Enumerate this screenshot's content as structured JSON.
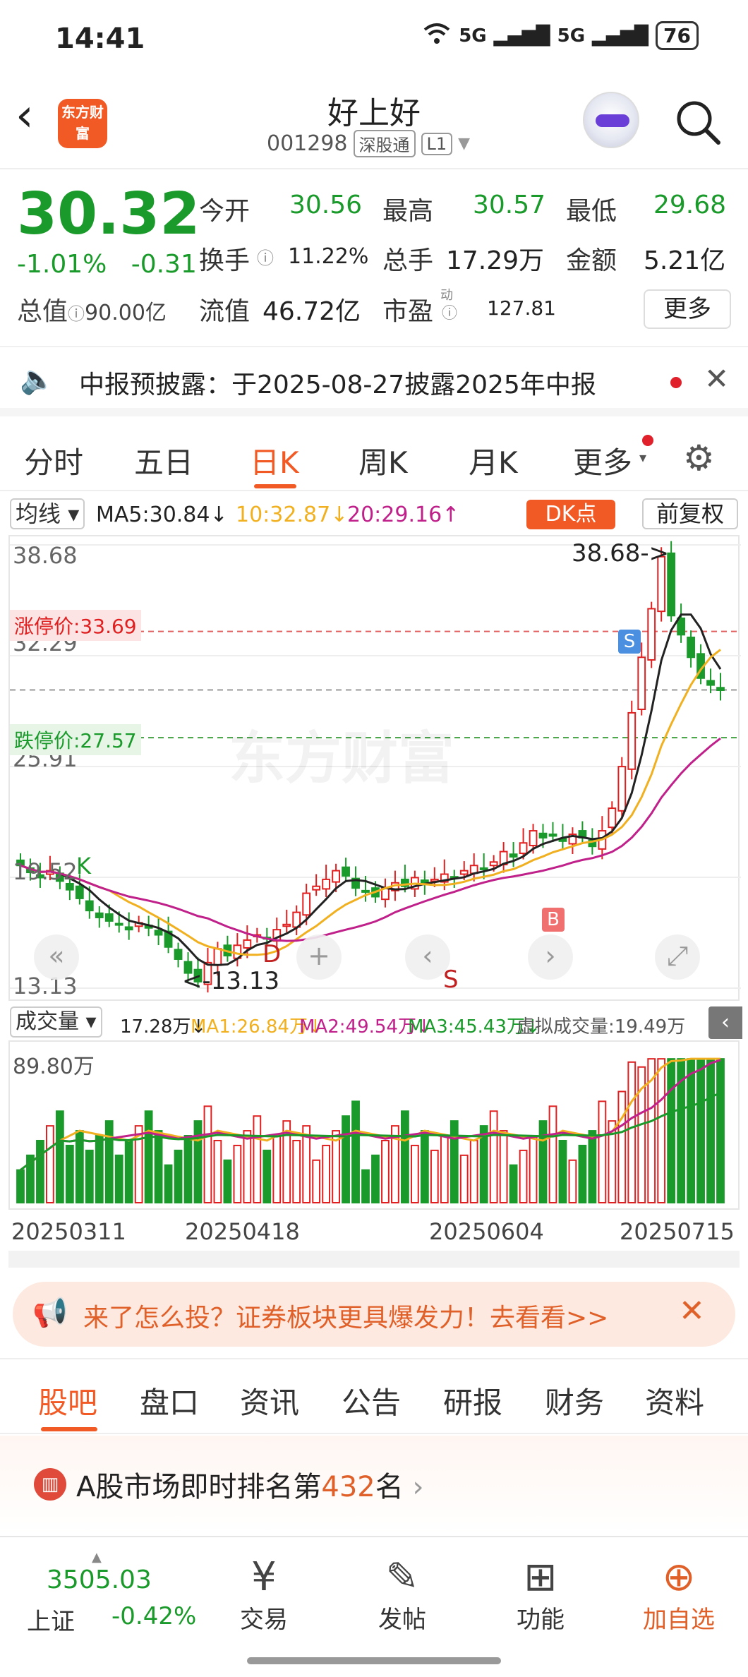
{
  "status_bar": {
    "time": "14:41",
    "signal1": "5G",
    "signal2": "5G",
    "battery": "76"
  },
  "header": {
    "logo": "东方财富",
    "name": "好上好",
    "code": "001298",
    "tag1": "深股通",
    "tag2": "L1"
  },
  "quote": {
    "price": "30.32",
    "change_pct": "-1.01%",
    "change": "-0.31",
    "items": [
      {
        "label": "今开",
        "value": "30.56",
        "color": "green"
      },
      {
        "label": "最高",
        "value": "30.57",
        "color": "green"
      },
      {
        "label": "最低",
        "value": "29.68",
        "color": "green"
      },
      {
        "label": "换手",
        "value": "11.22%",
        "color": "black"
      },
      {
        "label": "总手",
        "value": "17.29万",
        "color": "black"
      },
      {
        "label": "金额",
        "value": "5.21亿",
        "color": "black"
      },
      {
        "label": "流值",
        "value": "46.72亿",
        "color": "black"
      },
      {
        "label": "市盈",
        "value": "127.81",
        "color": "black"
      }
    ],
    "total_value_label": "总值",
    "total_value": "90.00亿",
    "pe_superscript": "动",
    "more": "更多"
  },
  "notice": {
    "text": "中报预披露：于2025-08-27披露2025年中报"
  },
  "chart_tabs": [
    "分时",
    "五日",
    "日K",
    "周K",
    "月K",
    "更多"
  ],
  "chart_tabs_active": "日K",
  "ma_row": {
    "selector": "均线",
    "ma5": "MA5:30.84↓",
    "ma10": "10:32.87↓",
    "ma20": "20:29.16↑",
    "dk": "DK点",
    "fq": "前复权"
  },
  "kline": {
    "y_high": "38.68",
    "y_mid1": "32.29",
    "y_mid2": "25.91",
    "y_mid3": "19.52",
    "y_low": "13.13",
    "limit_up": "涨停价:33.69",
    "limit_down": "跌停价:27.57",
    "max_marker": "38.68->",
    "min_marker": "<-13.13",
    "s_mark": "S",
    "b_mark": "B",
    "d_mark": "D",
    "k_mark": "K",
    "watermark": "东方财富"
  },
  "vol_row": {
    "selector": "成交量",
    "vol": "17.28万↓",
    "ma1": "MA1:26.84万↓",
    "ma2": "MA2:49.54万↓",
    "ma3": "MA3:45.43万↓",
    "virtual": "虚拟成交量:19.49万",
    "y_max": "89.80万"
  },
  "x_dates": [
    "20250311",
    "20250418",
    "20250604",
    "20250715"
  ],
  "ad": {
    "text": "来了怎么投？证券板块更具爆发力！去看看>>"
  },
  "info_tabs": [
    "股吧",
    "盘口",
    "资讯",
    "公告",
    "研报",
    "财务",
    "资料"
  ],
  "rank": {
    "prefix": "A股市场即时排名第",
    "num": "432",
    "suffix": "名"
  },
  "bottom_nav": {
    "index_value": "3505.03",
    "index_name": "上证",
    "index_change": "-0.42%",
    "items": [
      "交易",
      "发帖",
      "功能",
      "加自选"
    ]
  },
  "colors": {
    "up": "#e02020",
    "down": "#1a9a2a",
    "accent": "#f15a24",
    "ma5": "#222222",
    "ma10": "#f0b020",
    "ma20": "#c0208a"
  },
  "chart_data": {
    "type": "candlestick",
    "ylim": [
      13.13,
      38.68
    ],
    "closes": [
      20.2,
      19.8,
      19.5,
      19.9,
      19.3,
      18.8,
      18.3,
      17.6,
      17.2,
      17.0,
      16.8,
      16.5,
      16.9,
      16.6,
      16.2,
      15.5,
      14.8,
      14.0,
      13.5,
      14.6,
      15.4,
      15.0,
      15.6,
      15.9,
      16.2,
      16.0,
      16.5,
      16.8,
      17.5,
      18.6,
      19.0,
      19.4,
      19.9,
      19.6,
      18.9,
      18.7,
      18.4,
      18.9,
      19.2,
      19.0,
      19.5,
      19.1,
      19.4,
      19.7,
      19.5,
      19.9,
      20.2,
      20.0,
      20.4,
      21.0,
      20.7,
      21.5,
      22.2,
      21.8,
      21.9,
      21.6,
      22.0,
      21.8,
      21.3,
      22.2,
      23.5,
      25.9,
      29.0,
      32.2,
      35.0,
      38.0,
      34.6,
      33.5,
      32.2,
      31.0,
      30.6,
      30.3
    ]
  }
}
